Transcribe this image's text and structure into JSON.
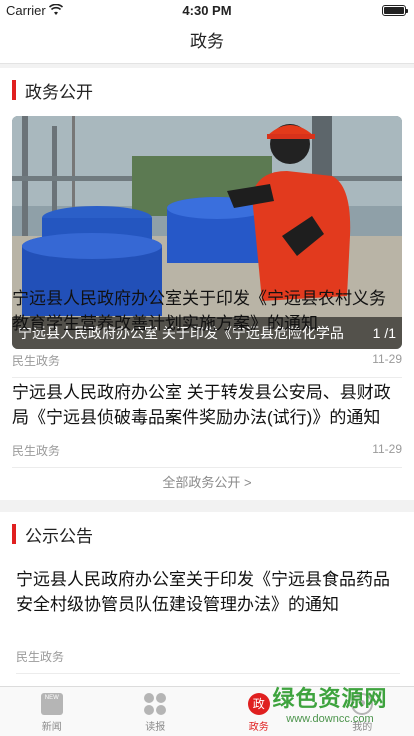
{
  "status_bar": {
    "carrier": "Carrier",
    "time": "4:30 PM"
  },
  "nav": {
    "title": "政务"
  },
  "sections": {
    "public_affairs": {
      "title": "政务公开",
      "banner": {
        "caption": "宁远县人民政府办公室 关于印发《宁远县危险化学品",
        "pager": "1 /1"
      },
      "items": [
        {
          "title": "宁远县人民政府办公室关于印发《宁远县农村义务教育学生营养改善计划实施方案》的通知",
          "category": "民生政务",
          "date": "11-29"
        },
        {
          "title": "宁远县人民政府办公室 关于转发县公安局、县财政局《宁远县侦破毒品案件奖励办法(试行)》的通知",
          "category": "民生政务",
          "date": "11-29"
        }
      ],
      "more": "全部政务公开 >"
    },
    "announcements": {
      "title": "公示公告",
      "items": [
        {
          "title": "宁远县人民政府办公室关于印发《宁远县食品药品安全村级协管员队伍建设管理办法》的通知",
          "category": "民生政务",
          "date": ""
        }
      ]
    }
  },
  "tabs": [
    {
      "label": "新闻",
      "icon": "news-icon",
      "icon_text": "NEW"
    },
    {
      "label": "读报",
      "icon": "read-icon"
    },
    {
      "label": "政务",
      "icon": "gov-icon",
      "icon_text": "政",
      "active": true
    },
    {
      "label": "我的",
      "icon": "me-icon"
    }
  ],
  "watermark": {
    "logo": "绿色资源网",
    "url": "www.downcc.com"
  },
  "colors": {
    "accent": "#e02020",
    "text": "#111111",
    "meta": "#9a9a9a"
  }
}
